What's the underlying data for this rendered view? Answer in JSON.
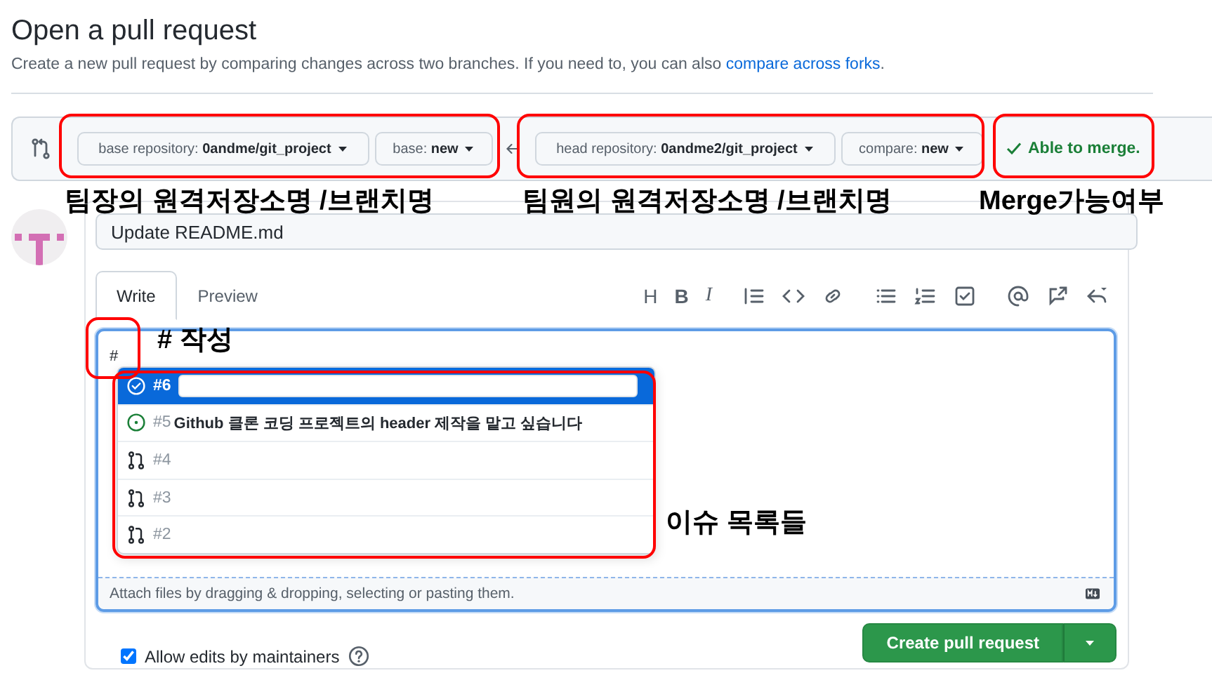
{
  "header": {
    "title": "Open a pull request",
    "subtitle": "Create a new pull request by comparing changes across two branches. If you need to, you can also ",
    "subtitle_link": "compare across forks",
    "subtitle_end": "."
  },
  "compare": {
    "selectors": [
      {
        "label": "base repository: ",
        "value": "0andme/git_project"
      },
      {
        "label": "base: ",
        "value": "new"
      },
      {
        "label": "head repository: ",
        "value": "0andme2/git_project"
      },
      {
        "label": "compare: ",
        "value": "new"
      }
    ],
    "merge_status": "Able to merge."
  },
  "form": {
    "title_value": "Update README.md",
    "tabs": [
      {
        "label": "Write",
        "selected": true
      },
      {
        "label": "Preview",
        "selected": false
      }
    ],
    "toolbar": [
      {
        "kind": "glyph",
        "text": "H"
      },
      {
        "kind": "bold-glyph",
        "text": "B"
      },
      {
        "kind": "italic-glyph",
        "text": "I"
      },
      {
        "kind": "quote"
      },
      {
        "kind": "code"
      },
      {
        "kind": "link"
      },
      {
        "kind": "bullets"
      },
      {
        "kind": "numbers"
      },
      {
        "kind": "tasks"
      },
      {
        "kind": "mention"
      },
      {
        "kind": "reference"
      },
      {
        "kind": "reply"
      }
    ],
    "body_value": "#",
    "suggestions": [
      {
        "kind": "closed-issue",
        "number": "#6",
        "selected": true,
        "redacted": true
      },
      {
        "kind": "open-issue",
        "number": "#5",
        "title": "Github 클론 코딩 프로젝트의 header 제작을 맡고 싶습니다",
        "selected": false,
        "redacted": false
      },
      {
        "kind": "pull-request",
        "number": "#4",
        "selected": false,
        "redacted": false
      },
      {
        "kind": "pull-request",
        "number": "#3",
        "selected": false,
        "redacted": false
      },
      {
        "kind": "pull-request",
        "number": "#2",
        "selected": false,
        "redacted": false
      }
    ],
    "attach_hint": "Attach files by dragging & dropping, selecting or pasting them.",
    "maintainers": {
      "label": "Allow edits by maintainers",
      "checked": true
    },
    "submit": "Create pull request"
  },
  "annotations": [
    {
      "kind": "box"
    },
    {
      "kind": "box"
    },
    {
      "kind": "box"
    },
    {
      "kind": "box"
    },
    {
      "kind": "box"
    },
    {
      "kind": "label",
      "text": "팀장의 원격저장소명 /브랜치명"
    },
    {
      "kind": "label",
      "text": "팀원의 원격저장소명 /브랜치명"
    },
    {
      "kind": "label",
      "text": "Merge가능여부"
    },
    {
      "kind": "label",
      "text": "# 작성"
    },
    {
      "kind": "label",
      "text": "이슈 목록들"
    }
  ]
}
